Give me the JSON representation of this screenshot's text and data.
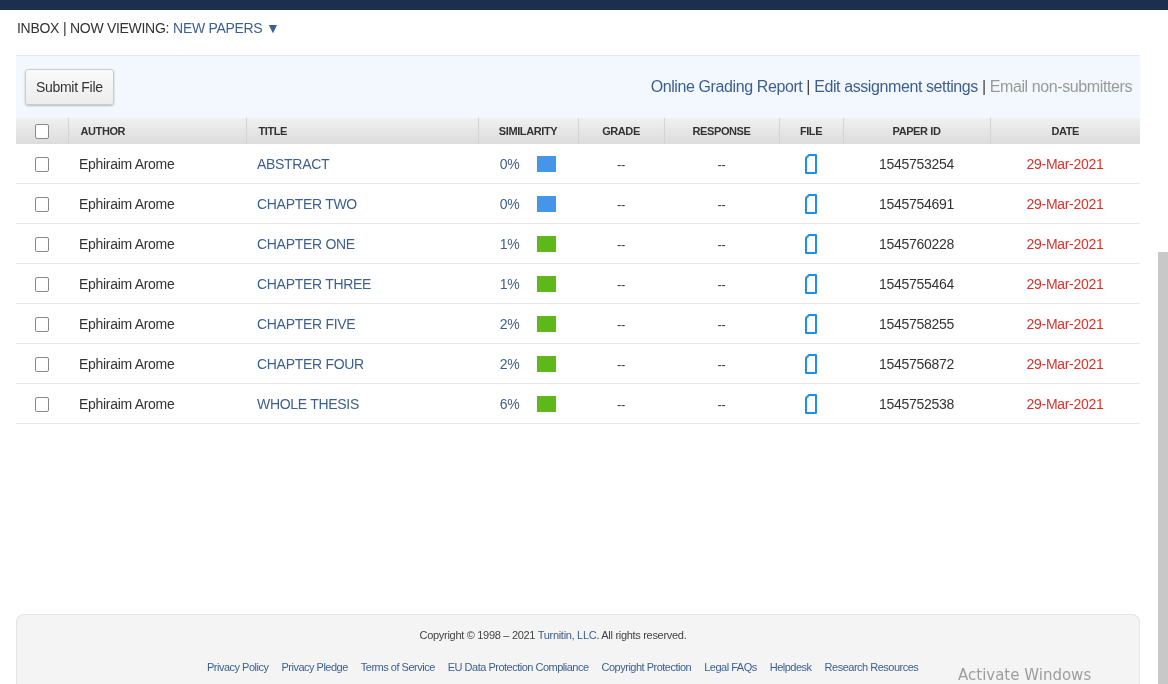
{
  "header": {
    "inbox": "INBOX",
    "viewing_label": "| NOW VIEWING:",
    "viewing_value": "NEW PAPERS",
    "dropdown_glyph": "▼"
  },
  "toolbar": {
    "submit_button": "Submit File",
    "links": [
      {
        "label": "Online Grading Report",
        "disabled": false
      },
      {
        "label": "Edit assignment settings",
        "disabled": false
      },
      {
        "label": "Email non-submitters",
        "disabled": true
      }
    ],
    "separator": "|"
  },
  "table": {
    "select_all": {
      "checked": false
    },
    "columns": [
      "AUTHOR",
      "TITLE",
      "SIMILARITY",
      "GRADE",
      "RESPONSE",
      "FILE",
      "PAPER ID",
      "DATE"
    ],
    "rows": [
      {
        "checked": false,
        "author": "Ephiraim Arome",
        "title": "ABSTRACT",
        "similarity": "0%",
        "color": "#4596e8",
        "grade": "--",
        "response": "--",
        "paper_id": "1545753254",
        "date": "29-Mar-2021"
      },
      {
        "checked": false,
        "author": "Ephiraim Arome",
        "title": "CHAPTER TWO",
        "similarity": "0%",
        "color": "#4596e8",
        "grade": "--",
        "response": "--",
        "paper_id": "1545754691",
        "date": "29-Mar-2021"
      },
      {
        "checked": false,
        "author": "Ephiraim Arome",
        "title": "CHAPTER ONE",
        "similarity": "1%",
        "color": "#5fb81b",
        "grade": "--",
        "response": "--",
        "paper_id": "1545760228",
        "date": "29-Mar-2021"
      },
      {
        "checked": false,
        "author": "Ephiraim Arome",
        "title": "CHAPTER THREE",
        "similarity": "1%",
        "color": "#5fb81b",
        "grade": "--",
        "response": "--",
        "paper_id": "1545755464",
        "date": "29-Mar-2021"
      },
      {
        "checked": false,
        "author": "Ephiraim Arome",
        "title": "CHAPTER FIVE",
        "similarity": "2%",
        "color": "#5fb81b",
        "grade": "--",
        "response": "--",
        "paper_id": "1545758255",
        "date": "29-Mar-2021"
      },
      {
        "checked": false,
        "author": "Ephiraim Arome",
        "title": "CHAPTER FOUR",
        "similarity": "2%",
        "color": "#5fb81b",
        "grade": "--",
        "response": "--",
        "paper_id": "1545756872",
        "date": "29-Mar-2021"
      },
      {
        "checked": false,
        "author": "Ephiraim Arome",
        "title": "WHOLE THESIS",
        "similarity": "6%",
        "color": "#5fb81b",
        "grade": "--",
        "response": "--",
        "paper_id": "1545752538",
        "date": "29-Mar-2021"
      }
    ]
  },
  "footer": {
    "copyright_before": "Copyright © 1998 – 2021",
    "company": "Turnitin, LLC",
    "copyright_after": ". All rights reserved.",
    "links": [
      "Privacy Policy",
      "Privacy Pledge",
      "Terms of Service",
      "EU Data Protection Compliance",
      "Copyright Protection",
      "Legal FAQs",
      "Helpdesk",
      "Research Resources"
    ]
  },
  "os_overlay": "Activate Windows"
}
